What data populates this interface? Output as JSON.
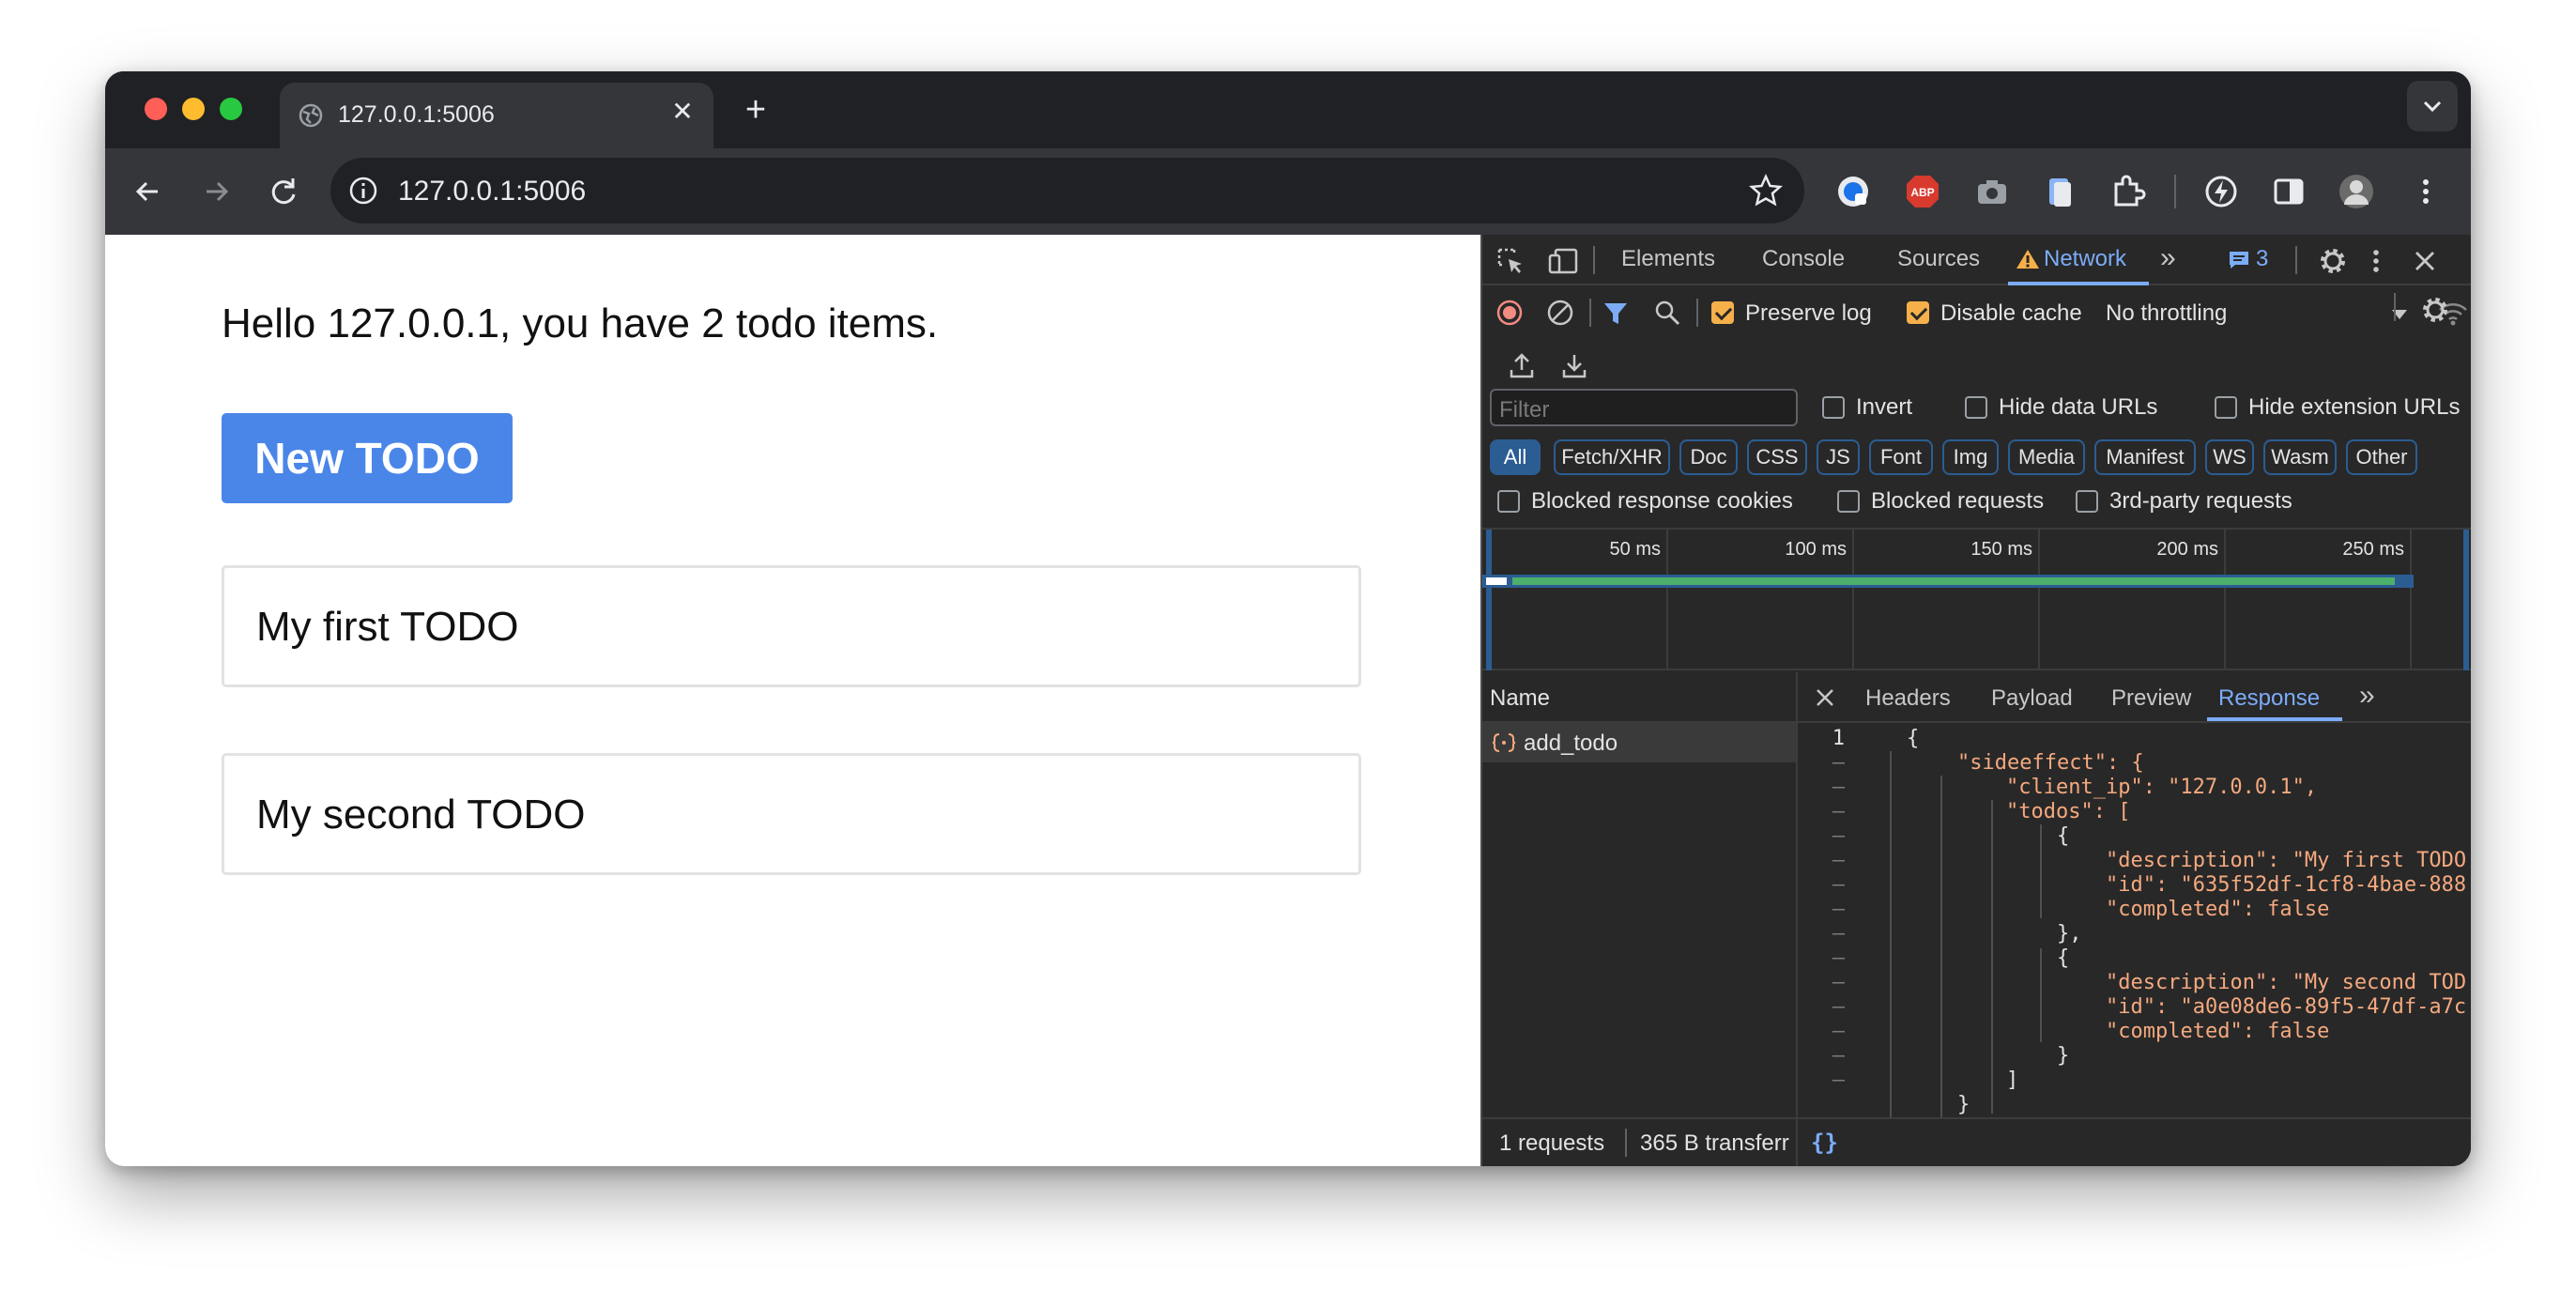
{
  "browser": {
    "tab_title": "127.0.0.1:5006",
    "url": "127.0.0.1:5006",
    "colors": {
      "close": "#ff5f57",
      "minimize": "#febc2e",
      "zoom": "#28c840"
    }
  },
  "page": {
    "greeting": "Hello 127.0.0.1, you have 2 todo items.",
    "new_button": "New TODO",
    "todos": [
      "My first TODO",
      "My second TODO"
    ]
  },
  "devtools": {
    "tabs": [
      "Elements",
      "Console",
      "Sources",
      "Network"
    ],
    "active_tab": "Network",
    "issues_count": "3",
    "preserve_log": "Preserve log",
    "disable_cache": "Disable cache",
    "throttling": "No throttling",
    "filter_placeholder": "Filter",
    "invert": "Invert",
    "hide_data_urls": "Hide data URLs",
    "hide_extension_urls": "Hide extension URLs",
    "type_filters": [
      "All",
      "Fetch/XHR",
      "Doc",
      "CSS",
      "JS",
      "Font",
      "Img",
      "Media",
      "Manifest",
      "WS",
      "Wasm",
      "Other"
    ],
    "blocked_cookies": "Blocked response cookies",
    "blocked_requests": "Blocked requests",
    "third_party": "3rd-party requests",
    "timeline_ticks": [
      "50 ms",
      "100 ms",
      "150 ms",
      "200 ms",
      "250 ms"
    ],
    "name_header": "Name",
    "request_name": "add_todo",
    "detail_tabs": [
      "Headers",
      "Payload",
      "Preview",
      "Response"
    ],
    "active_detail_tab": "Response",
    "line_number_first": "1",
    "line_marker": "–",
    "response_lines": [
      "{",
      "\"sideeffect\": {",
      "\"client_ip\": \"127.0.0.1\",",
      "\"todos\": [",
      "{",
      "\"description\": \"My first TODO",
      "\"id\": \"635f52df-1cf8-4bae-888",
      "\"completed\": false",
      "},",
      "{",
      "\"description\": \"My second TOD",
      "\"id\": \"a0e08de6-89f5-47df-a7c",
      "\"completed\": false",
      "}",
      "]",
      "}"
    ],
    "requests_count": "1 requests",
    "transferred": "365 B transferr",
    "pretty_print": "{}"
  }
}
